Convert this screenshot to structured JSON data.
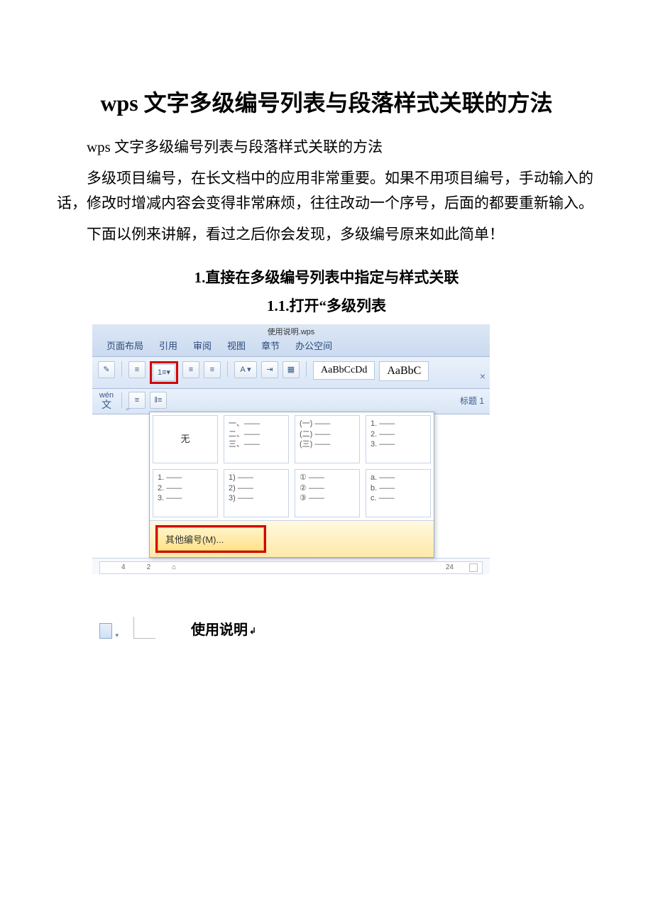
{
  "title": "wps 文字多级编号列表与段落样式关联的方法",
  "intro_line": "wps 文字多级编号列表与段落样式关联的方法",
  "para1": "多级项目编号，在长文档中的应用非常重要。如果不用项目编号，手动输入的话，修改时增减内容会变得非常麻烦，往往改动一个序号，后面的都要重新输入。",
  "para2": "下面以例来讲解，看过之后你会发现，多级编号原来如此简单！",
  "section1": "1.直接在多级编号列表中指定与样式关联",
  "section1_1": "1.1.打开“多级列表",
  "screenshot": {
    "titlebar": "使用说明.wps",
    "tabs": [
      "页面布局",
      "引用",
      "审阅",
      "视图",
      "章节",
      "办公空间"
    ],
    "style_sample1": "AaBbCcDd",
    "style_sample2": "AaBbC",
    "style_label": "标题 1",
    "wen_label_top": "wén",
    "wen_label_bottom": "文",
    "corner_label": "⌐",
    "ruler_marks": [
      "4",
      "2"
    ],
    "ruler_right": "24",
    "dropdown": {
      "none": "无",
      "cells_row1": [
        "一、——\n二、——\n三、——",
        "(一) ——\n(二) ——\n(三) ——",
        "1. ——\n2. ——\n3. ——"
      ],
      "cells_row2": [
        "1. ——\n2. ——\n3. ——",
        "1) ——\n2) ——\n3) ——",
        "① ——\n② ——\n③ ——",
        "a. ——\nb. ——\nc. ——"
      ],
      "footer": "其他编号(M)..."
    }
  },
  "below_text": "使用说明"
}
